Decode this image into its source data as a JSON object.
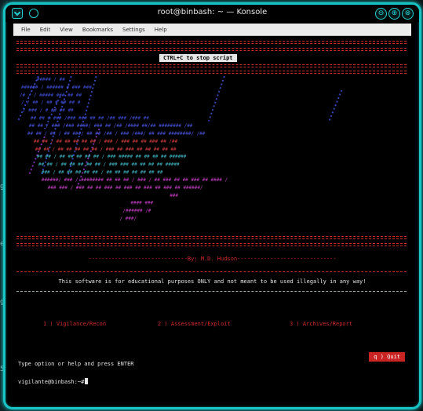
{
  "background": {
    "side_fragments": [
      "gn",
      "e",
      "gn",
      "5"
    ]
  },
  "window": {
    "title": "root@binbash: ~ — Konsole",
    "accent_color": "#19c4c4",
    "buttons": {
      "minimize": "⊖",
      "maximize": "⊕",
      "close": "⊗"
    }
  },
  "menu": [
    "File",
    "Edit",
    "View",
    "Bookmarks",
    "Settings",
    "Help"
  ],
  "terminal": {
    "ctrl_banner": "CTRL+C to stop script",
    "author": "------------------------------By: M.D. Hudson------------------------------",
    "disclaimer": "This software is for educational purposes ONLY and not meant to be used illegally in any way!",
    "options": [
      {
        "label": "1 ) Vigilance/Recon",
        "color": "#d12a2a"
      },
      {
        "label": "2 ) Assessment/Exploit",
        "color": "#d12a2a"
      },
      {
        "label": "3 ) Archives/Report",
        "color": "#d12a2a"
      }
    ],
    "quit_label": "q ) Quit",
    "input_prompt": "Type option or help and press ENTER",
    "shell_prompt": "vigilante@binbash:~#"
  },
  "colors": {
    "rule": "#d12a2a",
    "art_blue": "#3f4fd6",
    "art_purple": "#9b3fd6",
    "art_red": "#d63f3f",
    "art_teal": "#3fb8c8",
    "art_magenta": "#c83fc8"
  }
}
